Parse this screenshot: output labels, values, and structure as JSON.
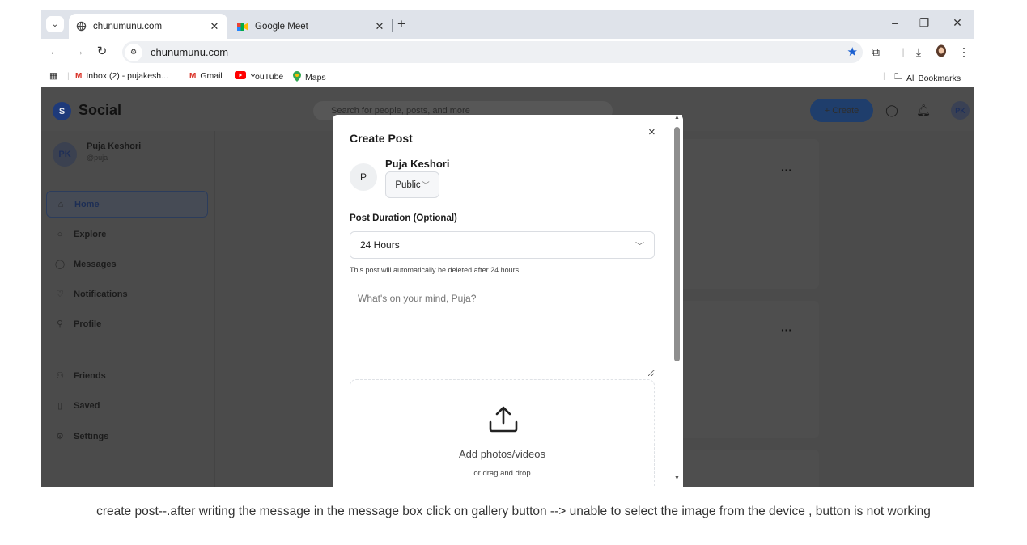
{
  "browser": {
    "tabs": [
      {
        "title": "chunumunu.com",
        "active": true
      },
      {
        "title": "Google Meet",
        "active": false
      }
    ],
    "url": "chunumunu.com",
    "bookmarks": [
      {
        "label": "Inbox (2) - pujakesh..."
      },
      {
        "label": "Gmail"
      },
      {
        "label": "YouTube"
      },
      {
        "label": "Maps"
      }
    ],
    "all_bookmarks": "All Bookmarks"
  },
  "app": {
    "logo_letter": "S",
    "name": "Social",
    "search_placeholder": "Search for people, posts, and more",
    "create_label": "+ Create",
    "avatar_initials": "PK"
  },
  "sidebar": {
    "profile_initials": "PK",
    "profile_name": "Puja Keshori",
    "profile_handle": "@puja",
    "items": [
      {
        "label": "Home",
        "icon": "home-icon"
      },
      {
        "label": "Explore",
        "icon": "search-icon"
      },
      {
        "label": "Messages",
        "icon": "chat-icon"
      },
      {
        "label": "Notifications",
        "icon": "heart-icon"
      },
      {
        "label": "Profile",
        "icon": "user-icon"
      },
      {
        "label": "Friends",
        "icon": "users-icon"
      },
      {
        "label": "Saved",
        "icon": "bookmark-icon"
      },
      {
        "label": "Settings",
        "icon": "gear-icon"
      }
    ]
  },
  "modal": {
    "title": "Create Post",
    "close": "×",
    "user_initial": "P",
    "user_name": "Puja Keshori",
    "visibility": "Public",
    "duration_label": "Post Duration (Optional)",
    "duration_value": "24 Hours",
    "duration_help": "This post will automatically be deleted after 24 hours",
    "message_placeholder": "What's on your mind, Puja?",
    "upload_title": "Add photos/videos",
    "upload_subtitle": "or drag and drop"
  },
  "caption": "create post--.after writing the message in the message box click on gallery button --> unable to select the image from the device , button is not working"
}
